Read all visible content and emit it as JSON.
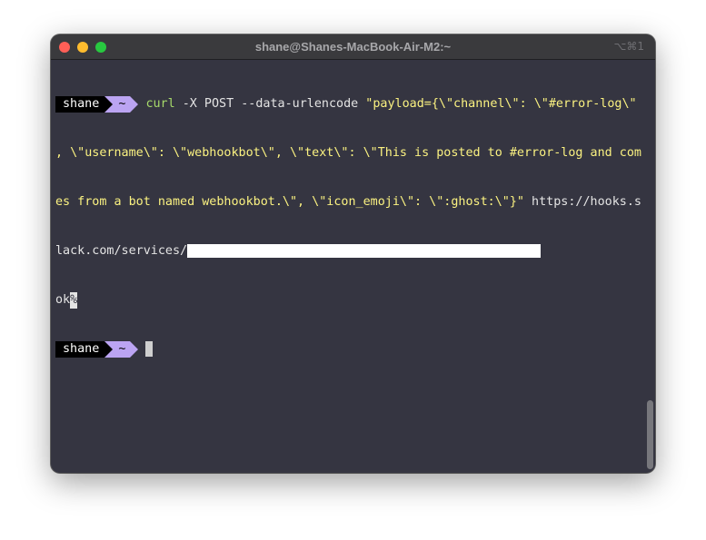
{
  "window": {
    "title": "shane@Shanes-MacBook-Air-M2:~",
    "shortcut": "⌥⌘1"
  },
  "prompt": {
    "user": "shane",
    "dir": "~"
  },
  "command": {
    "program": "curl",
    "args": " -X POST --data-urlencode ",
    "payload_lines": [
      "\"payload={\\\"channel\\\": \\\"#error-log\\\"",
      ", \\\"username\\\": \\\"webhookbot\\\", \\\"text\\\": \\\"This is posted to #error-log and com",
      "es from a bot named webhookbot.\\\", \\\"icon_emoji\\\": \\\":ghost:\\\"}\""
    ],
    "url_part1": " https://hooks.s",
    "url_part2": "lack.com/services/"
  },
  "output": {
    "response": "ok",
    "no_newline_marker": "%"
  },
  "colors": {
    "background": "#353541",
    "command": "#a6d96a",
    "string": "#fbf281",
    "prompt_dir_bg": "#bba4f2",
    "prompt_user_bg": "#000000"
  }
}
